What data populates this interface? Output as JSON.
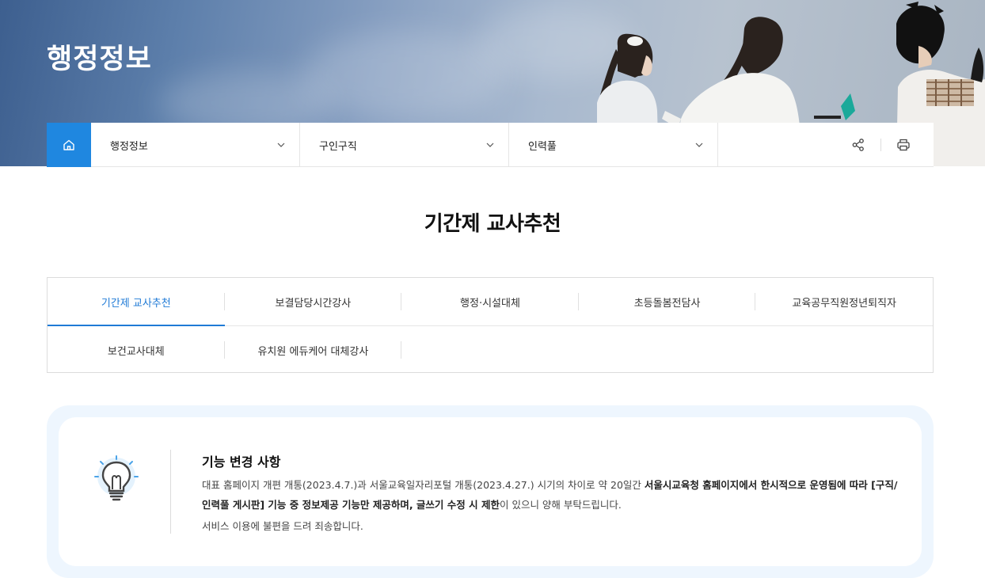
{
  "hero": {
    "title": "행정정보"
  },
  "nav": {
    "home_icon": "home-icon",
    "selects": [
      {
        "label": "행정정보"
      },
      {
        "label": "구인구직"
      },
      {
        "label": "인력풀"
      }
    ],
    "tools": {
      "share_icon": "share-icon",
      "print_icon": "print-icon"
    }
  },
  "page": {
    "title": "기간제 교사추천"
  },
  "tabs": {
    "row1": [
      "기간제 교사추천",
      "보결담당시간강사",
      "행정·시설대체",
      "초등돌봄전담사",
      "교육공무직원정년퇴직자"
    ],
    "row2": [
      "보건교사대체",
      "유치원 에듀케어 대체강사"
    ],
    "active": "기간제 교사추천"
  },
  "notice": {
    "icon": "lightbulb-icon",
    "title": "기능 변경 사항",
    "body_part1": "대표 홈페이지 개편 개통(2023.4.7.)과 서울교육일자리포털 개통(2023.4.27.) 시기의 차이로 약 20일간 ",
    "body_bold": "서울시교육청 홈페이지에서 한시적으로 운영됨에 따라 [구직/인력풀 게시판] 기능 중 정보제공 기능만 제공하며, 글쓰기 수정 시 제한",
    "body_part2": "이 있으니 양해 부탁드립니다.",
    "footer": "서비스 이용에 불편을 드려 죄송합니다."
  },
  "colors": {
    "accent": "#1f87e0",
    "active_tab": "#1f7ad6",
    "notice_bg": "#eef6fe"
  }
}
